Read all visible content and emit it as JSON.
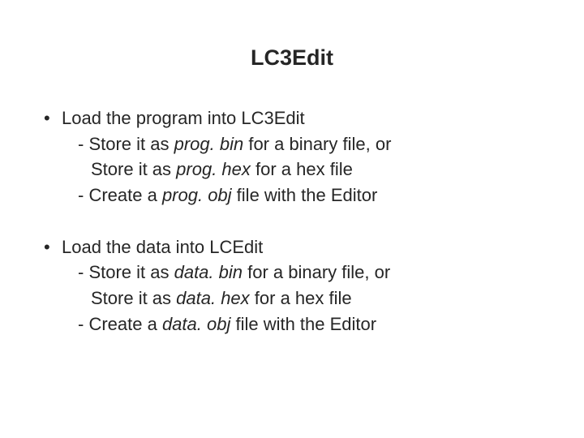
{
  "title": "LC3Edit",
  "block1": {
    "main": "Load the program into LC3Edit",
    "sub1_a": " - Store it as ",
    "sub1_b": "prog. bin",
    "sub1_c": " for a binary file, or",
    "sub1b_a": "Store it as ",
    "sub1b_b": "prog. hex",
    "sub1b_c": " for a hex file",
    "sub2_a": "- Create a ",
    "sub2_b": "prog. obj",
    "sub2_c": " file with the Editor"
  },
  "block2": {
    "main": "Load the data into LCEdit",
    "sub1_a": " - Store it as ",
    "sub1_b": "data. bin",
    "sub1_c": " for a binary file, or",
    "sub1b_a": "Store it as ",
    "sub1b_b": "data. hex",
    "sub1b_c": " for a hex file",
    "sub2_a": "- Create a ",
    "sub2_b": "data. obj",
    "sub2_c": " file with the Editor"
  }
}
